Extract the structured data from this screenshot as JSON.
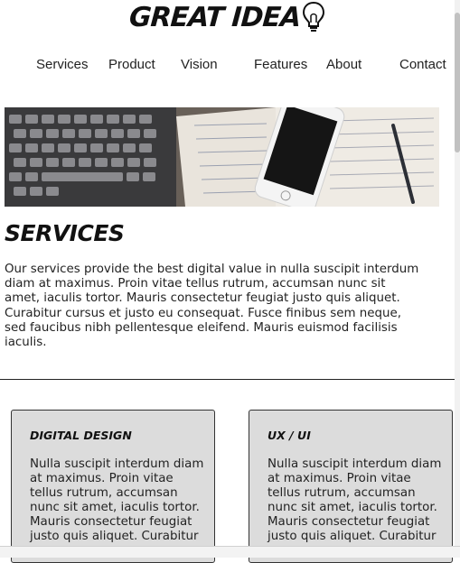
{
  "header": {
    "brand": "GREAT IDEA",
    "brand_icon": "lightbulb-icon"
  },
  "nav": {
    "items": [
      {
        "label": "Services"
      },
      {
        "label": "Product"
      },
      {
        "label": "Vision"
      },
      {
        "label": "Features"
      },
      {
        "label": "About"
      },
      {
        "label": "Contact"
      }
    ]
  },
  "hero": {
    "image": "laptop-phone-notebook-photo"
  },
  "services": {
    "title": "SERVICES",
    "intro": "Our services provide the best digital value in nulla suscipit interdum diam at maximus. Proin vitae tellus rutrum, accumsan nunc sit amet, iaculis tortor. Mauris consectetur feugiat justo quis aliquet. Curabitur cursus et justo eu consequat. Fusce finibus sem neque, sed faucibus nibh pellentesque eleifend. Mauris euismod facilisis iaculis."
  },
  "cards": [
    {
      "title": "DIGITAL DESIGN",
      "body": "Nulla suscipit interdum diam at maximus. Proin vitae tellus rutrum, accumsan nunc sit amet, iaculis tortor. Mauris consectetur feugiat justo quis aliquet. Curabitur"
    },
    {
      "title": "UX / UI",
      "body": "Nulla suscipit interdum diam at maximus. Proin vitae tellus rutrum, accumsan nunc sit amet, iaculis tortor. Mauris consectetur feugiat justo quis aliquet. Curabitur"
    }
  ]
}
